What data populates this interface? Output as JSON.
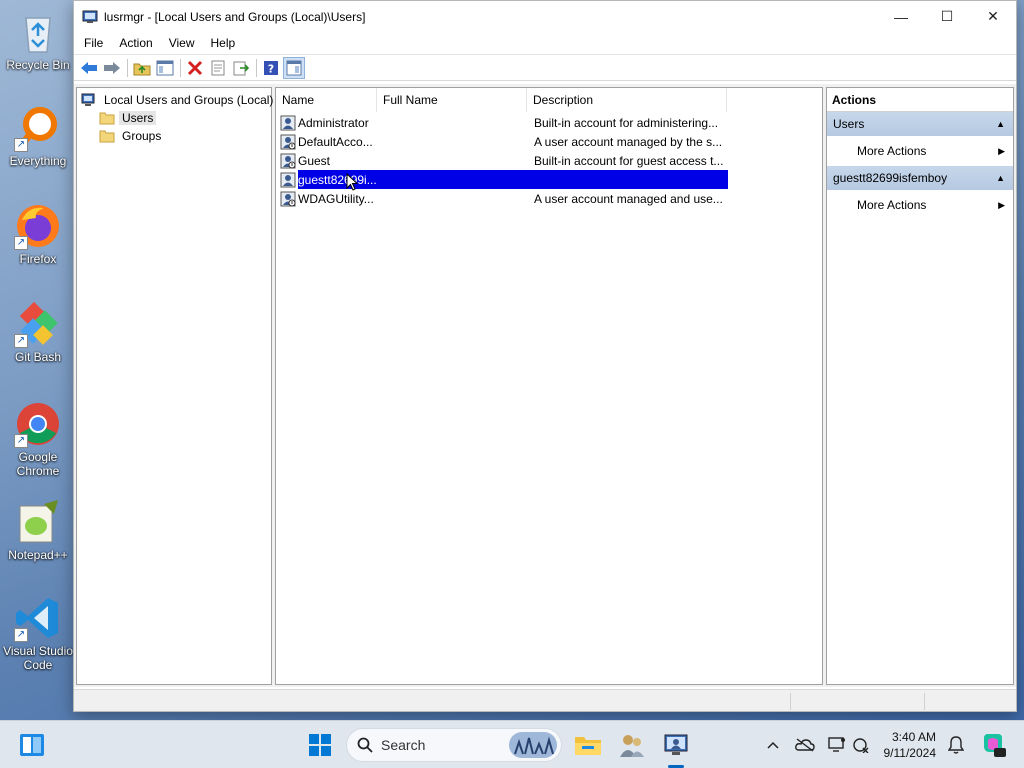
{
  "window": {
    "title": "lusrmgr - [Local Users and Groups (Local)\\Users]",
    "minimize": "—",
    "maximize": "☐",
    "close": "✕"
  },
  "menu": [
    "File",
    "Action",
    "View",
    "Help"
  ],
  "toolbar_icons": [
    "back-icon",
    "forward-icon",
    "up-folder-icon",
    "show-tree-icon",
    "delete-icon",
    "properties-icon",
    "export-icon",
    "help-icon",
    "show-action-pane-icon"
  ],
  "tree": {
    "root": "Local Users and Groups (Local)",
    "items": [
      "Users",
      "Groups"
    ]
  },
  "list": {
    "columns": [
      "Name",
      "Full Name",
      "Description"
    ],
    "rows": [
      {
        "name": "Administrator",
        "full_name": "",
        "description": "Built-in account for administering..."
      },
      {
        "name": "DefaultAcco...",
        "full_name": "",
        "description": "A user account managed by the s..."
      },
      {
        "name": "Guest",
        "full_name": "",
        "description": "Built-in account for guest access t..."
      },
      {
        "name": "guestt82699i...",
        "full_name": "",
        "description": ""
      },
      {
        "name": "WDAGUtility...",
        "full_name": "",
        "description": "A user account managed and use..."
      }
    ],
    "selected_row": 3
  },
  "actions": {
    "title": "Actions",
    "sections": [
      {
        "label": "Users",
        "items": [
          "More Actions"
        ]
      },
      {
        "label": "guestt82699isfemboy",
        "items": [
          "More Actions"
        ]
      }
    ]
  },
  "desktop": {
    "icons": [
      "Recycle Bin",
      "Everything",
      "Firefox",
      "Git Bash",
      "Google Chrome",
      "Notepad++",
      "Visual Studio Code"
    ]
  },
  "taskbar": {
    "search_placeholder": "Search",
    "time": "3:40 AM",
    "date": "9/11/2024"
  },
  "colors": {
    "selection": "#0000e6",
    "actions_header": "#c6d7ea",
    "taskbar": "#dfe6ee"
  }
}
